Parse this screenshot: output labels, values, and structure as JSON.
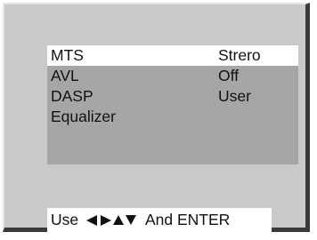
{
  "menu": {
    "items": [
      {
        "label": "MTS",
        "value": "Strero",
        "selected": true
      },
      {
        "label": "AVL",
        "value": "Off",
        "selected": false
      },
      {
        "label": "DASP",
        "value": "User",
        "selected": false
      },
      {
        "label": "Equalizer",
        "value": "",
        "selected": false
      }
    ]
  },
  "footer": {
    "prefix": "Use",
    "icons": [
      "left-arrow-icon",
      "right-arrow-icon",
      "up-arrow-icon",
      "down-arrow-icon"
    ],
    "suffix": "And ENTER"
  },
  "colors": {
    "panel": "#c9c9c9",
    "menu_box": "#a6a6a6",
    "selected_row": "#ffffff",
    "panel_shadow": "#3a3a3a"
  }
}
